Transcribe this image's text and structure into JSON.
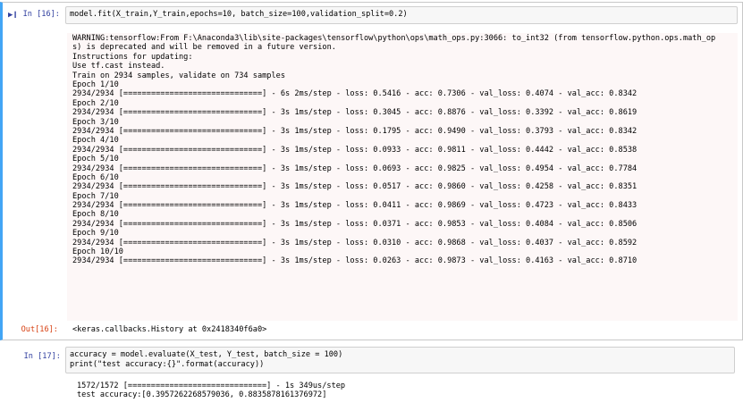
{
  "cells": [
    {
      "in_prompt": "In  [16]:",
      "code": "model.fit(X_train,Y_train,epochs=10, batch_size=100,validation_split=0.2)",
      "warning_lines": [
        "WARNING:tensorflow:From F:\\Anaconda3\\lib\\site-packages\\tensorflow\\python\\ops\\math_ops.py:3066: to_int32 (from tensorflow.python.ops.math_op",
        "s) is deprecated and will be removed in a future version.",
        "Instructions for updating:",
        "Use tf.cast instead.",
        "Train on 2934 samples, validate on 734 samples"
      ],
      "epochs": [
        {
          "label": "Epoch 1/10",
          "progress": "2934/2934 [==============================] - 6s 2ms/step - loss: 0.5416 - acc: 0.7306 - val_loss: 0.4074 - val_acc: 0.8342"
        },
        {
          "label": "Epoch 2/10",
          "progress": "2934/2934 [==============================] - 3s 1ms/step - loss: 0.3045 - acc: 0.8876 - val_loss: 0.3392 - val_acc: 0.8619"
        },
        {
          "label": "Epoch 3/10",
          "progress": "2934/2934 [==============================] - 3s 1ms/step - loss: 0.1795 - acc: 0.9490 - val_loss: 0.3793 - val_acc: 0.8342"
        },
        {
          "label": "Epoch 4/10",
          "progress": "2934/2934 [==============================] - 3s 1ms/step - loss: 0.0933 - acc: 0.9811 - val_loss: 0.4442 - val_acc: 0.8538"
        },
        {
          "label": "Epoch 5/10",
          "progress": "2934/2934 [==============================] - 3s 1ms/step - loss: 0.0693 - acc: 0.9825 - val_loss: 0.4954 - val_acc: 0.7784"
        },
        {
          "label": "Epoch 6/10",
          "progress": "2934/2934 [==============================] - 3s 1ms/step - loss: 0.0517 - acc: 0.9860 - val_loss: 0.4258 - val_acc: 0.8351"
        },
        {
          "label": "Epoch 7/10",
          "progress": "2934/2934 [==============================] - 3s 1ms/step - loss: 0.0411 - acc: 0.9869 - val_loss: 0.4723 - val_acc: 0.8433"
        },
        {
          "label": "Epoch 8/10",
          "progress": "2934/2934 [==============================] - 3s 1ms/step - loss: 0.0371 - acc: 0.9853 - val_loss: 0.4084 - val_acc: 0.8506"
        },
        {
          "label": "Epoch 9/10",
          "progress": "2934/2934 [==============================] - 3s 1ms/step - loss: 0.0310 - acc: 0.9868 - val_loss: 0.4037 - val_acc: 0.8592"
        },
        {
          "label": "Epoch 10/10",
          "progress": "2934/2934 [==============================] - 3s 1ms/step - loss: 0.0263 - acc: 0.9873 - val_loss: 0.4163 - val_acc: 0.8710"
        }
      ],
      "out_prompt": "Out[16]:",
      "out_value": "<keras.callbacks.History at 0x2418340f6a0>"
    },
    {
      "in_prompt": "In  [17]:",
      "code_line1": "accuracy = model.evaluate(X_test, Y_test, batch_size = 100)",
      "code_line2": "print(\"test accuracy:{}\".format(accuracy))",
      "stream_lines": [
        "1572/1572 [==============================] - 1s 349us/step",
        "test accuracy:[0.3957262268579036, 0.8835878161376972]"
      ]
    }
  ],
  "colors": {
    "selected_border": "#42a5f5",
    "in_prompt": "#303f9f",
    "out_prompt": "#d84315",
    "number": "#008800",
    "string": "#ba2121"
  }
}
